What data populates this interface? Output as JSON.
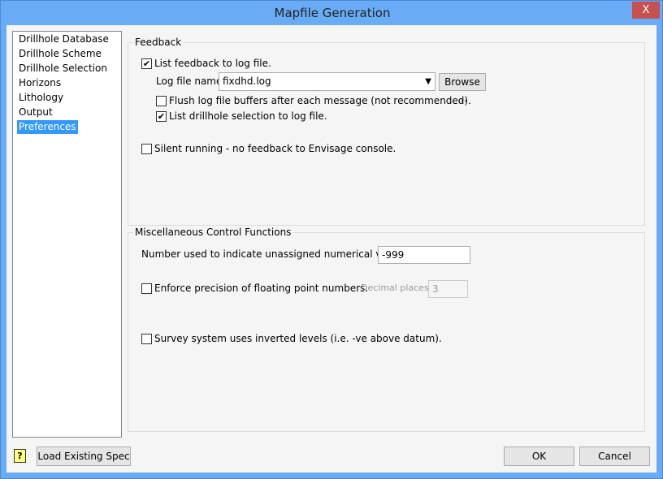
{
  "window": {
    "title": "Mapfile Generation",
    "close_label": "X"
  },
  "nav": {
    "items": [
      "Drillhole Database",
      "Drillhole Scheme",
      "Drillhole Selection",
      "Horizons",
      "Lithology",
      "Output",
      "Preferences"
    ],
    "selected": "Preferences"
  },
  "feedback": {
    "legend": "Feedback",
    "list_feedback": {
      "label": "List feedback to log file.",
      "checked": true
    },
    "log_file_label": "Log file name",
    "log_file_value": "fixdhd.log",
    "browse_label": "Browse ...",
    "flush": {
      "label": "Flush log file buffers after each message (not recommended).",
      "checked": false
    },
    "list_selection": {
      "label": "List drillhole selection to log file.",
      "checked": true
    },
    "silent": {
      "label": "Silent running - no feedback to Envisage console.",
      "checked": false
    }
  },
  "misc": {
    "legend": "Miscellaneous Control Functions",
    "unassigned_label": "Number used to indicate unassigned numerical values",
    "unassigned_value": "-999",
    "precision": {
      "label": "Enforce precision of floating point numbers.",
      "checked": false
    },
    "decimal_label": "Decimal places",
    "decimal_value": "3",
    "inverted": {
      "label": "Survey system uses inverted levels (i.e. -ve above datum).",
      "checked": false
    }
  },
  "footer": {
    "help_icon": "?",
    "load_label": "Load Existing Spec",
    "ok_label": "OK",
    "cancel_label": "Cancel"
  },
  "colors": {
    "title_bar": "#6aabf5",
    "close": "#c75050",
    "selection": "#3399ff"
  }
}
